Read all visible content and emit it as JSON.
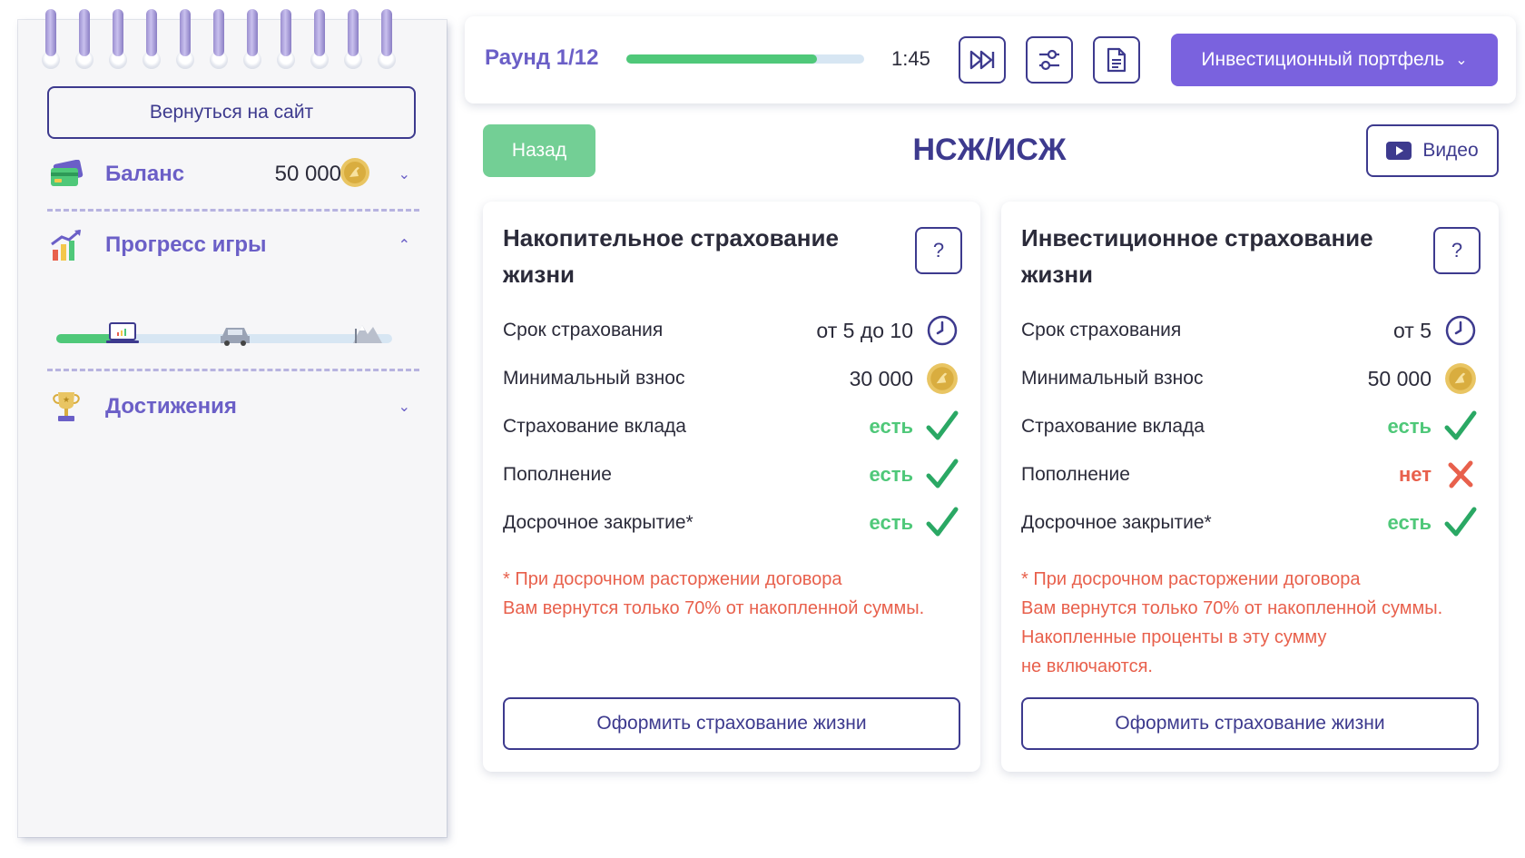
{
  "sidebar": {
    "back_to_site": "Вернуться на сайт",
    "balance": {
      "label": "Баланс",
      "value": "50 000"
    },
    "progress": {
      "label": "Прогресс игры",
      "fill_fraction": 0.2
    },
    "achievements": {
      "label": "Достижения"
    }
  },
  "topbar": {
    "round": "Раунд 1/12",
    "round_progress_fraction": 0.8,
    "timer": "1:45",
    "portfolio_button": "Инвестиционный портфель"
  },
  "header": {
    "back_button": "Назад",
    "title": "НСЖ/ИСЖ",
    "video_button": "Видео"
  },
  "cards": [
    {
      "title": "Накопительное страхование жизни",
      "help": "?",
      "rows": [
        {
          "label": "Срок страхования",
          "value": "от 5 до 10",
          "icon": "clock-icon"
        },
        {
          "label": "Минимальный взнос",
          "value": "30 000",
          "icon": "coin-icon"
        },
        {
          "label": "Страхование вклада",
          "value": "есть",
          "icon": "check-icon"
        },
        {
          "label": "Пополнение",
          "value": "есть",
          "icon": "check-icon"
        },
        {
          "label": "Досрочное закрытие*",
          "value": "есть",
          "icon": "check-icon"
        }
      ],
      "note_lines": [
        "* При досрочном расторжении договора",
        "Вам вернутся только 70% от накопленной суммы."
      ],
      "action": "Оформить страхование жизни"
    },
    {
      "title": "Инвестиционное страхование жизни",
      "help": "?",
      "rows": [
        {
          "label": "Срок страхования",
          "value": "от 5",
          "icon": "clock-icon"
        },
        {
          "label": "Минимальный взнос",
          "value": "50 000",
          "icon": "coin-icon"
        },
        {
          "label": "Страхование вклада",
          "value": "есть",
          "icon": "check-icon"
        },
        {
          "label": "Пополнение",
          "value": "нет",
          "icon": "cross-icon"
        },
        {
          "label": "Досрочное закрытие*",
          "value": "есть",
          "icon": "check-icon"
        }
      ],
      "note_lines": [
        "* При досрочном расторжении договора",
        "Вам вернутся только 70% от накопленной суммы.",
        "Накопленные проценты в эту сумму",
        "не включаются."
      ],
      "action": "Оформить страхование жизни"
    }
  ],
  "colors": {
    "accent": "#6b5fc7",
    "primary_dark": "#3d3a8e",
    "portfolio_button": "#7a62de",
    "success": "#4fc879",
    "danger": "#e8604c",
    "back_button": "#73cf95"
  }
}
